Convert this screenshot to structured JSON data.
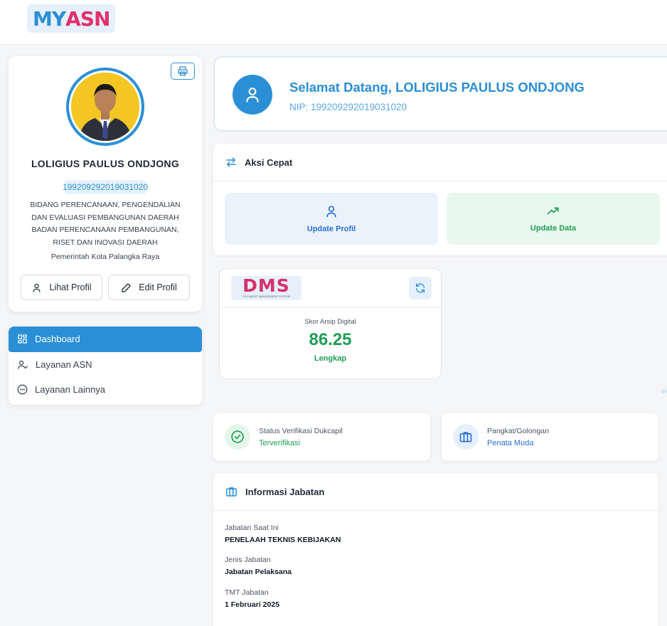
{
  "header": {
    "logo_my": "MY",
    "logo_asn": "ASN"
  },
  "profile": {
    "name": "LOLIGIUS PAULUS ONDJONG",
    "nip": "199209292019031020",
    "unit": "BIDANG PERENCANAAN, PENGENDALIAN DAN EVALUASI PEMBANGUNAN DAERAH BADAN PERENCANAAN PEMBANGUNAN, RISET DAN INOVASI DAERAH",
    "pemda": "Pemerintah Kota Palangka Raya",
    "lihat_label": "Lihat Profil",
    "edit_label": "Edit Profil"
  },
  "sidebar": {
    "items": [
      {
        "label": "Dashboard",
        "icon": "grid-icon",
        "active": true
      },
      {
        "label": "Layanan ASN",
        "icon": "user-check-icon",
        "active": false
      },
      {
        "label": "Layanan Lainnya",
        "icon": "more-circle-icon",
        "active": false
      }
    ]
  },
  "welcome": {
    "title": "Selamat Datang, LOLIGIUS PAULUS ONDJONG",
    "nip": "NIP: 199209292019031020"
  },
  "aksi": {
    "title": "Aksi Cepat",
    "update_profil": "Update Profil",
    "update_data": "Update Data"
  },
  "dms": {
    "logo_text": "DMS",
    "logo_sub": "DOCUMENT MANAGEMENT SYSTEM",
    "label": "Skor Arsip Digital",
    "score": "86.25",
    "status": "Lengkap"
  },
  "status_cards": {
    "verif_label": "Status Verifikasi Dukcapil",
    "verif_value": "Terverifikasi",
    "pangkat_label": "Pangkat/Golongan",
    "pangkat_value": "Penata Muda"
  },
  "jabatan": {
    "title": "Informasi Jabatan",
    "rows": [
      {
        "key": "Jabatan Saat Ini",
        "value": "PENELAAH TEKNIS KEBIJAKAN"
      },
      {
        "key": "Jenis Jabatan",
        "value": "Jabatan Pelaksana"
      },
      {
        "key": "TMT Jabatan",
        "value": "1 Februari 2025"
      }
    ]
  },
  "colors": {
    "primary": "#2b8fd6",
    "brand_pink": "#e0306b",
    "success": "#1f9d55"
  }
}
